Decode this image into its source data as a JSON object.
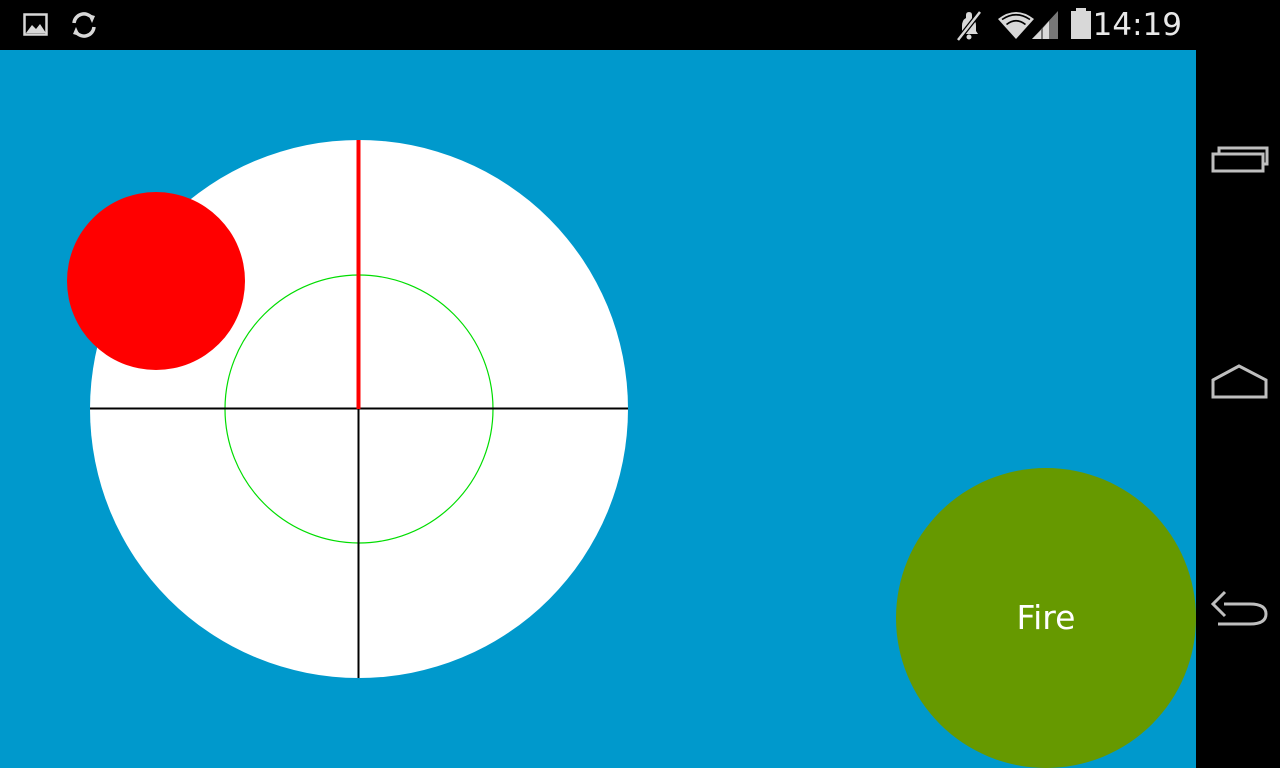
{
  "status_bar": {
    "time": "14:19",
    "left_icons": [
      "image-icon",
      "sync-icon"
    ],
    "right_icons": [
      "mute-icon",
      "wifi-icon",
      "signal-icon",
      "battery-icon"
    ]
  },
  "game": {
    "fire_label": "Fire",
    "colors": {
      "background": "#0099cc",
      "target_face": "#ffffff",
      "puck": "#ff0000",
      "needle": "#ff0000",
      "inner_ring": "#00dd00",
      "crosshair": "#000000",
      "fire_button": "#669900"
    }
  },
  "nav_bar": {
    "buttons": [
      "recent-apps",
      "home",
      "back"
    ]
  }
}
